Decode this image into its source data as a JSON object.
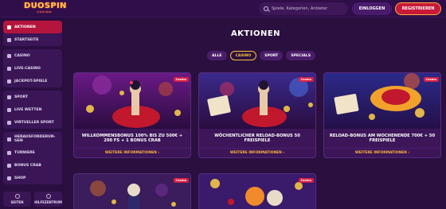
{
  "header": {
    "logo": "DUOSPIN",
    "logo_tagline": "CASINO",
    "search_placeholder": "Spiele, Kategorien, Anbieter",
    "login_label": "EINLOGGEN",
    "register_label": "REGISTRIEREN"
  },
  "sidebar": {
    "groups": [
      [
        {
          "label": "AKTIONEN",
          "icon": "gift-icon",
          "active": true
        },
        {
          "label": "STARTSEITE",
          "icon": "home-icon"
        }
      ],
      [
        {
          "label": "CASINO",
          "icon": "cards-icon"
        },
        {
          "label": "LIVE-CASINO",
          "icon": "live-icon"
        },
        {
          "label": "JACKPOT-SPIELE",
          "icon": "jackpot-icon"
        }
      ],
      [
        {
          "label": "SPORT",
          "icon": "ball-icon"
        },
        {
          "label": "LIVE WETTEN",
          "icon": "live-bet-icon"
        },
        {
          "label": "VIRTUELLER SPORT",
          "icon": "virtual-icon"
        }
      ],
      [
        {
          "label": "HERAUSFORDERUN-GEN",
          "icon": "trophy-icon"
        },
        {
          "label": "TURNIERE",
          "icon": "tournament-icon"
        },
        {
          "label": "BONUS CRAB",
          "icon": "crab-icon"
        },
        {
          "label": "SHOP",
          "icon": "shop-icon"
        }
      ]
    ],
    "bottom": [
      {
        "label": "SEITEN",
        "icon": "pages-icon"
      },
      {
        "label": "HILFEZENTRUM",
        "icon": "help-icon"
      }
    ]
  },
  "main": {
    "title": "AKTIONEN",
    "filters": [
      "ALLE",
      "CASINO",
      "SPORT",
      "SPECIALS"
    ],
    "active_filter": "CASINO",
    "more_label": "WEITERE INFORMATIONEN",
    "cards": [
      {
        "title": "WILLKOMMENSBONUS 100% BIS ZU 500€ + 200 FS + 1 BONUS CRAB",
        "badge": "Casino"
      },
      {
        "title": "WÖCHENTLICHER RELOAD-BONUS 50 FREISPIELE",
        "badge": "Casino"
      },
      {
        "title": "RELOAD-BONUS AM WOCHENENDE 700€ + 50 FREISPIELE",
        "badge": "Casino"
      },
      {
        "title": "",
        "badge": "Casino"
      },
      {
        "title": "",
        "badge": "Casino"
      }
    ]
  },
  "colors": {
    "accent": "#ffb43b",
    "brand_red": "#c8193a",
    "background": "#2a0f3f"
  }
}
